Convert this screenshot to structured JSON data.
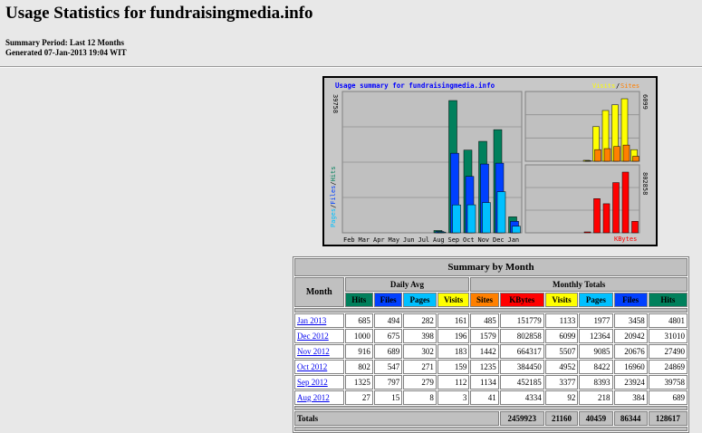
{
  "header": {
    "title": "Usage Statistics for fundraisingmedia.info",
    "summary_period": "Summary Period: Last 12 Months",
    "generated": "Generated 07-Jan-2013 19:04 WIT"
  },
  "colors": {
    "hits": "#00805c",
    "files": "#0040ff",
    "pages": "#00c0ff",
    "visits": "#ffff00",
    "sites": "#ff8000",
    "kbytes": "#ff0000",
    "chart_bg": "#c8c8c8",
    "title_blue": "#0000ff"
  },
  "chart_data": {
    "type": "bar",
    "title": "Usage summary for fundraisingmedia.info",
    "y_axis_left_label": [
      "Pages",
      "/",
      "Files",
      "/",
      "Hits"
    ],
    "y_max_hits": "39758",
    "y_max_visits": "6099",
    "y_max_kbytes": "802858",
    "legend_visits": "Visits",
    "legend_sep": "/",
    "legend_sites": "Sites",
    "legend_kbytes": "KBytes",
    "months": [
      "Feb",
      "Mar",
      "Apr",
      "May",
      "Jun",
      "Jul",
      "Aug",
      "Sep",
      "Oct",
      "Nov",
      "Dec",
      "Jan"
    ],
    "series": {
      "hits": [
        0,
        0,
        0,
        0,
        0,
        0,
        689,
        39758,
        24869,
        27490,
        31010,
        4801
      ],
      "files": [
        0,
        0,
        0,
        0,
        0,
        0,
        384,
        23924,
        16960,
        20676,
        20942,
        3458
      ],
      "pages": [
        0,
        0,
        0,
        0,
        0,
        0,
        218,
        8393,
        8422,
        9085,
        12364,
        1977
      ],
      "visits": [
        0,
        0,
        0,
        0,
        0,
        0,
        92,
        3377,
        4952,
        5507,
        6099,
        1133
      ],
      "sites": [
        0,
        0,
        0,
        0,
        0,
        0,
        41,
        1134,
        1235,
        1442,
        1579,
        485
      ],
      "kbytes": [
        0,
        0,
        0,
        0,
        0,
        0,
        4334,
        452185,
        384450,
        664317,
        802858,
        151779
      ]
    }
  },
  "table": {
    "caption": "Summary by Month",
    "month_header": "Month",
    "daily_avg_header": "Daily Avg",
    "monthly_totals_header": "Monthly Totals",
    "daily_cols": [
      "Hits",
      "Files",
      "Pages",
      "Visits"
    ],
    "monthly_cols": [
      "Sites",
      "KBytes",
      "Visits",
      "Pages",
      "Files",
      "Hits"
    ],
    "rows": [
      {
        "month": "Jan 2013",
        "d_hits": "685",
        "d_files": "494",
        "d_pages": "282",
        "d_visits": "161",
        "sites": "485",
        "kbytes": "151779",
        "visits": "1133",
        "pages": "1977",
        "files": "3458",
        "hits": "4801"
      },
      {
        "month": "Dec 2012",
        "d_hits": "1000",
        "d_files": "675",
        "d_pages": "398",
        "d_visits": "196",
        "sites": "1579",
        "kbytes": "802858",
        "visits": "6099",
        "pages": "12364",
        "files": "20942",
        "hits": "31010"
      },
      {
        "month": "Nov 2012",
        "d_hits": "916",
        "d_files": "689",
        "d_pages": "302",
        "d_visits": "183",
        "sites": "1442",
        "kbytes": "664317",
        "visits": "5507",
        "pages": "9085",
        "files": "20676",
        "hits": "27490"
      },
      {
        "month": "Oct 2012",
        "d_hits": "802",
        "d_files": "547",
        "d_pages": "271",
        "d_visits": "159",
        "sites": "1235",
        "kbytes": "384450",
        "visits": "4952",
        "pages": "8422",
        "files": "16960",
        "hits": "24869"
      },
      {
        "month": "Sep 2012",
        "d_hits": "1325",
        "d_files": "797",
        "d_pages": "279",
        "d_visits": "112",
        "sites": "1134",
        "kbytes": "452185",
        "visits": "3377",
        "pages": "8393",
        "files": "23924",
        "hits": "39758"
      },
      {
        "month": "Aug 2012",
        "d_hits": "27",
        "d_files": "15",
        "d_pages": "8",
        "d_visits": "3",
        "sites": "41",
        "kbytes": "4334",
        "visits": "92",
        "pages": "218",
        "files": "384",
        "hits": "689"
      }
    ],
    "totals": {
      "label": "Totals",
      "kbytes": "2459923",
      "visits": "21160",
      "pages": "40459",
      "files": "86344",
      "hits": "128617"
    }
  }
}
